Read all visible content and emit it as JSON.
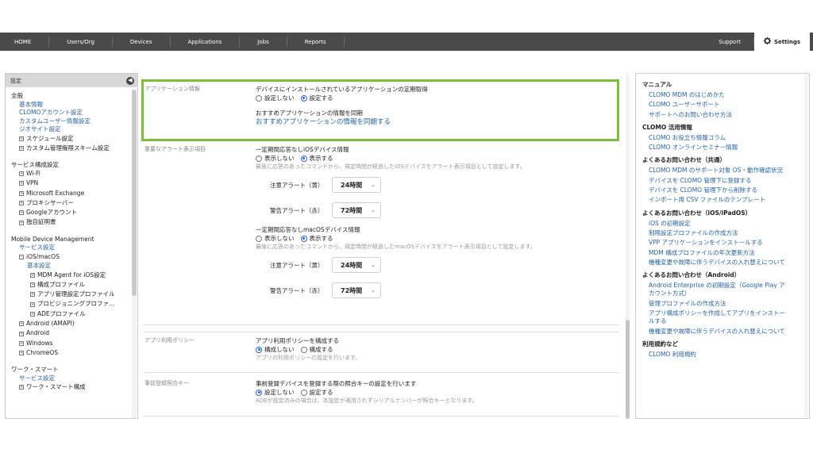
{
  "nav": {
    "items": [
      "HOME",
      "Users/Org",
      "Devices",
      "Applications",
      "Jobs",
      "Reports"
    ],
    "support": "Support",
    "settings": "Settings"
  },
  "sidebar": {
    "header": "設定",
    "collapse_glyph": "◀",
    "general": {
      "title": "全般",
      "links": [
        "基本情報",
        "CLOMOアカウント設定",
        "カスタムユーザー情報設定",
        "ジオサイト設定"
      ],
      "trees": [
        "スケジュール設定",
        "カスタム管理権限スキーム設定"
      ]
    },
    "services": {
      "title": "サービス構成設定",
      "trees": [
        "Wi-Fi",
        "VPN",
        "Microsoft Exchange",
        "プロキシサーバー",
        "Googleアカウント",
        "独自証明書"
      ]
    },
    "mdm": {
      "title": "Mobile Device Management",
      "service_link": "サービス設定",
      "ios": "iOS/macOS",
      "ios_basic": "基本設定",
      "ios_trees": [
        "MDM Agent for iOS設定",
        "構成プロファイル",
        "アプリ管理設定プロファイル",
        "プロビジョニングプロファ…",
        "ADEプロファイル"
      ],
      "others": [
        "Android (AMAPI)",
        "Android",
        "Windows",
        "ChromeOS"
      ]
    },
    "work": {
      "title": "ワーク・スマート",
      "service_link": "サービス設定",
      "trees": [
        "ワーク・スマート構成"
      ]
    }
  },
  "main": {
    "app_info": {
      "label": "アプリケーション情報",
      "field_title": "デバイスにインストールされているアプリケーションの定期取得",
      "options": [
        "設定しない",
        "設定する"
      ],
      "selected": 1,
      "sync_title": "おすすめアプリケーションの情報を同期",
      "sync_link": "おすすめアプリケーションの情報を同期する"
    },
    "alerts": {
      "label": "重要なアラート表示項目",
      "ios": {
        "title": "一定期間応答なしiOSデバイス情報",
        "options": [
          "表示しない",
          "表示する"
        ],
        "selected": 1,
        "hint": "最後に応答のあったコマンドから、規定時間が経過したiOSデバイスをアラート表示項目として設定します。",
        "caution_label": "注意アラート（黄）",
        "caution_value": "24時間",
        "warning_label": "警告アラート（赤）",
        "warning_value": "72時間"
      },
      "mac": {
        "title": "一定期間応答なしmacOSデバイス情報",
        "options": [
          "表示しない",
          "表示する"
        ],
        "selected": 1,
        "hint": "最後に応答のあったコマンドから、規定時間が経過したmacOSデバイスをアラート表示項目として設定します。",
        "caution_label": "注意アラート（黄）",
        "caution_value": "24時間",
        "warning_label": "警告アラート（赤）",
        "warning_value": "72時間"
      }
    },
    "app_policy": {
      "label": "アプリ利用ポリシー",
      "title": "アプリ利用ポリシーを構成する",
      "options": [
        "構成しない",
        "構成する"
      ],
      "selected": 0,
      "hint": "アプリの利用ポリシーの設定を行います。"
    },
    "prereg": {
      "label": "事前登録照合キー",
      "title": "事前登録デバイスを登録する際の照合キーの設定を行います",
      "options": [
        "設定しない",
        "設定する"
      ],
      "selected": 0,
      "hint": "ADEが設定済みの場合は、本設定が適用されずシリアルナンバーが照合キーとなります。"
    }
  },
  "right": {
    "sections": [
      {
        "heading": "マニュアル",
        "links": [
          "CLOMO MDM のはじめかた",
          "CLOMO ユーザーサポート",
          "サポートへのお問い合わせ方法"
        ]
      },
      {
        "heading": "CLOMO 活用情報",
        "links": [
          "CLOMO お役立ち情報コラム",
          "CLOMO オンラインセミナー情報"
        ]
      },
      {
        "heading": "よくあるお問い合わせ（共通）",
        "links": [
          "CLOMO MDM のサポート対象 OS・動作確認状況",
          "デバイスを CLOMO 管理下に登録する",
          "デバイスを CLOMO 管理下から削除する",
          "インポート用 CSV ファイルのテンプレート"
        ]
      },
      {
        "heading": "よくあるお問い合わせ（iOS/iPadOS）",
        "links": [
          "iOS の初期設定",
          "制限設定プロファイルの作成方法",
          "VPP アプリケーションをインストールする",
          "MDM 構成プロファイルの年次更新方法",
          "機種変更や故障に伴うデバイスの入れ替えについて"
        ]
      },
      {
        "heading": "よくあるお問い合わせ（Android）",
        "links": [
          "Android Enterprise の初期設定（Google Play アカウント方式）",
          "管理プロファイルの作成方法",
          "アプリ構成ポリシーを作成してアプリをインストールする",
          "機種変更や故障に伴うデバイスの入れ替えについて"
        ]
      },
      {
        "heading": "利用規約など",
        "links": [
          "CLOMO 利用規約"
        ]
      }
    ]
  },
  "colors": {
    "accent_link": "#2563a8",
    "highlight": "#7cbf3a",
    "nav_bg": "#4a4a4a"
  },
  "icons": {
    "settings": "gear-icon",
    "collapse": "chevron-left-icon",
    "dropdown": "chevron-down-icon"
  }
}
